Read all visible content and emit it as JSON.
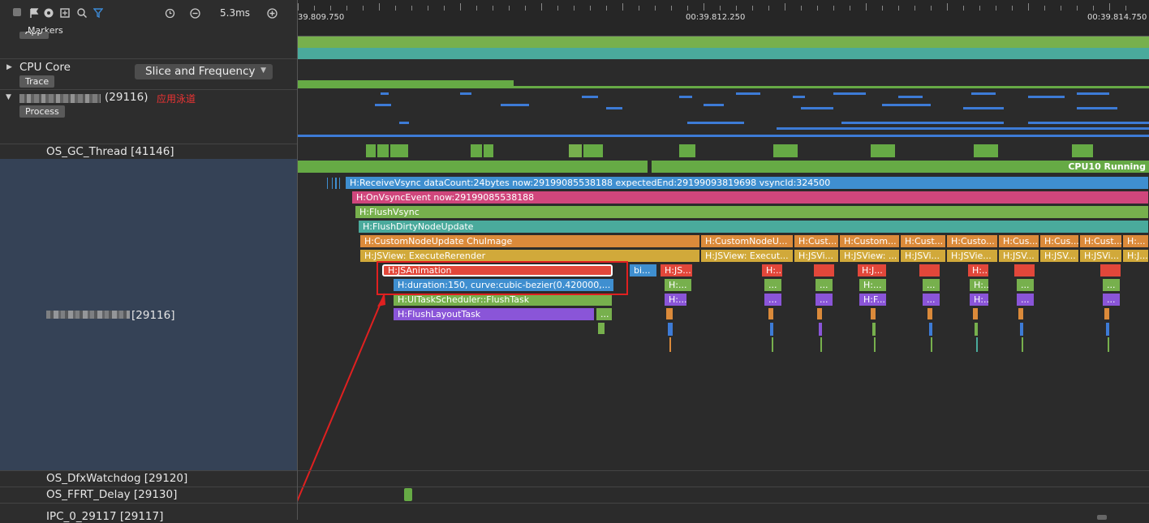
{
  "toolbar": {
    "zoom_value": "5.3ms"
  },
  "ruler": {
    "t0": "39.809.750",
    "t1": "00:39.812.250",
    "t2": "00:39.814.750"
  },
  "left_panel": {
    "markers_label": "Markers",
    "app_tag": "App",
    "cpu_core_label": "CPU Core",
    "cpu_mode_select": "Slice and Frequency",
    "trace_tag": "Trace",
    "process_pid": "(29116)",
    "process_annotation": "应用泳道",
    "process_tag": "Process",
    "threads": [
      {
        "name": "OS_GC_Thread [41146]"
      },
      {
        "name": "[29116]"
      },
      {
        "name": "OS_DfxWatchdog [29120]"
      },
      {
        "name": "OS_FFRT_Delay [29130]"
      },
      {
        "name": "IPC_0_29117 [29117]"
      }
    ]
  },
  "trace": {
    "cpu_state": "CPU10 Running",
    "slices": {
      "receive_vsync": "H:ReceiveVsync dataCount:24bytes now:29199085538188 expectedEnd:29199093819698 vsyncId:324500",
      "on_vsync_event": "H:OnVsyncEvent now:29199085538188",
      "flush_vsync": "H:FlushVsync",
      "flush_dirty": "H:FlushDirtyNodeUpdate",
      "custom_node_update": "H:CustomNodeUpdate ChuImage",
      "custom_node_more": [
        "H:CustomNodeU...",
        "H:Cust...",
        "H:Custom...",
        "H:Cust...",
        "H:Custo...",
        "H:Cus...",
        "H:Cus...",
        "H:Cust...",
        "H:..."
      ],
      "execute_rerender": "H:JSView: ExecuteRerender",
      "execute_more": [
        "H:JSView: Execut...",
        "H:JSVi...",
        "H:JSView: ...",
        "H:JSVi...",
        "H:JSVie...",
        "H:JSV...",
        "H:JSV...",
        "H:JSVi...",
        "H:J..."
      ],
      "js_animation": "H:JSAnimation",
      "bi": "bi...",
      "js_small": "H:JS...",
      "duration": "H:duration:150, curve:cubic-bezier(0.420000,...",
      "ui_task": "H:UITaskScheduler::FlushTask",
      "flush_layout": "H:FlushLayoutTask",
      "ellipsis": "...",
      "h_dots": "H:...",
      "hf_dots": "H:F...",
      "hj_dots": "H:J..."
    }
  },
  "colors": {
    "blue": "#3f8fd0",
    "pink": "#d0467c",
    "green": "#77b04d",
    "teal": "#4aaa9c",
    "orange": "#db8a3a",
    "yellow": "#d1a93a",
    "red": "#e2473a",
    "purple": "#8a55d8",
    "highlight": "#e02020"
  }
}
